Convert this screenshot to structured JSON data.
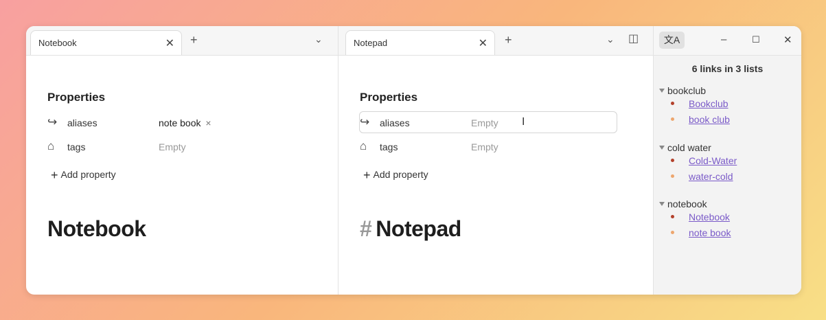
{
  "colors": {
    "bullet_primary": "#b3402a",
    "bullet_secondary": "#eda66e",
    "link": "#7a5ac8"
  },
  "left_pane": {
    "tab_title": "Notebook",
    "properties_heading": "Properties",
    "properties": [
      {
        "icon": "arrow-forward-icon",
        "key": "aliases",
        "value": "note book",
        "remove": "×"
      },
      {
        "icon": "tags-icon",
        "key": "tags",
        "value": "Empty"
      }
    ],
    "add_property_label": "Add property",
    "note_title": "Notebook"
  },
  "middle_pane": {
    "tab_title": "Notepad",
    "properties_heading": "Properties",
    "properties": [
      {
        "icon": "arrow-forward-icon",
        "key": "aliases",
        "value": "Empty"
      },
      {
        "icon": "tags-icon",
        "key": "tags",
        "value": "Empty"
      }
    ],
    "add_property_label": "Add property",
    "note_title_hash": "#",
    "note_title": "Notepad"
  },
  "right_panel": {
    "summary": "6 links in 3 lists",
    "groups": [
      {
        "title": "bookclub",
        "links": [
          "Bookclub",
          "book club"
        ]
      },
      {
        "title": "cold water",
        "links": [
          "Cold-Water",
          "water-cold"
        ]
      },
      {
        "title": "notebook",
        "links": [
          "Notebook",
          "note book"
        ]
      }
    ]
  }
}
